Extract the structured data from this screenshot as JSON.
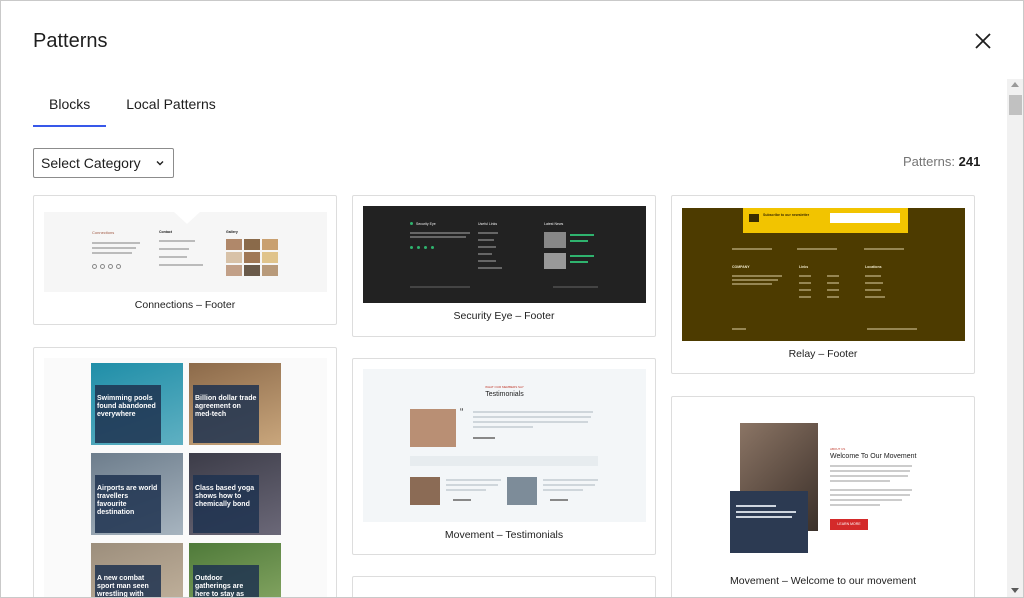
{
  "header": {
    "title": "Patterns"
  },
  "tabs": [
    {
      "label": "Blocks",
      "active": true
    },
    {
      "label": "Local Patterns",
      "active": false
    }
  ],
  "filter": {
    "category_label": "Select Category"
  },
  "count": {
    "label": "Patterns: ",
    "value": "241"
  },
  "accent_color": "#3858e9",
  "patterns": [
    {
      "label": "Connections – Footer"
    },
    {
      "label": "Security Eye – Footer"
    },
    {
      "label": "Relay – Footer"
    },
    {
      "label": ""
    },
    {
      "label": "Movement – Testimonials"
    },
    {
      "label": "Movement – Welcome to our movement"
    }
  ],
  "connections": {
    "heading": "Connections",
    "contact": "Contact",
    "gallery": "Gallery"
  },
  "security": {
    "brand": "Security Eye",
    "useful_links": "Useful Links",
    "latest_news": "Latest News"
  },
  "relay": {
    "newsletter": "Subscribe to our newsletter",
    "company": "COMPANY",
    "links": "Links",
    "locations": "Locations"
  },
  "news_tiles": [
    {
      "headline": "Swimming pools found abandoned everywhere",
      "colors": [
        "#1f8ea8",
        "#5fb0c2"
      ]
    },
    {
      "headline": "Billion dollar trade agreement on med-tech",
      "colors": [
        "#8c6a4a",
        "#c9a67c"
      ]
    },
    {
      "headline": "Airports are world travellers favourite destination",
      "colors": [
        "#6d7d8c",
        "#a7b4bf"
      ]
    },
    {
      "headline": "Class based yoga shows how to chemically bond",
      "colors": [
        "#3c3c48",
        "#6b6878"
      ]
    },
    {
      "headline": "A new combat sport man seen wrestling with speed bump",
      "colors": [
        "#9c8e7c",
        "#c8b8a2"
      ]
    },
    {
      "headline": "Outdoor gatherings are here to stay as climate makes a change",
      "colors": [
        "#4f7a3a",
        "#8fae6a"
      ]
    }
  ],
  "testimonials": {
    "eyebrow": "WHAT OUR MEMBERS SAY",
    "heading": "Testimonials"
  },
  "welcome": {
    "eyebrow": "ABOUT US",
    "heading": "Welcome To Our Movement",
    "button": "LEARN MORE"
  }
}
